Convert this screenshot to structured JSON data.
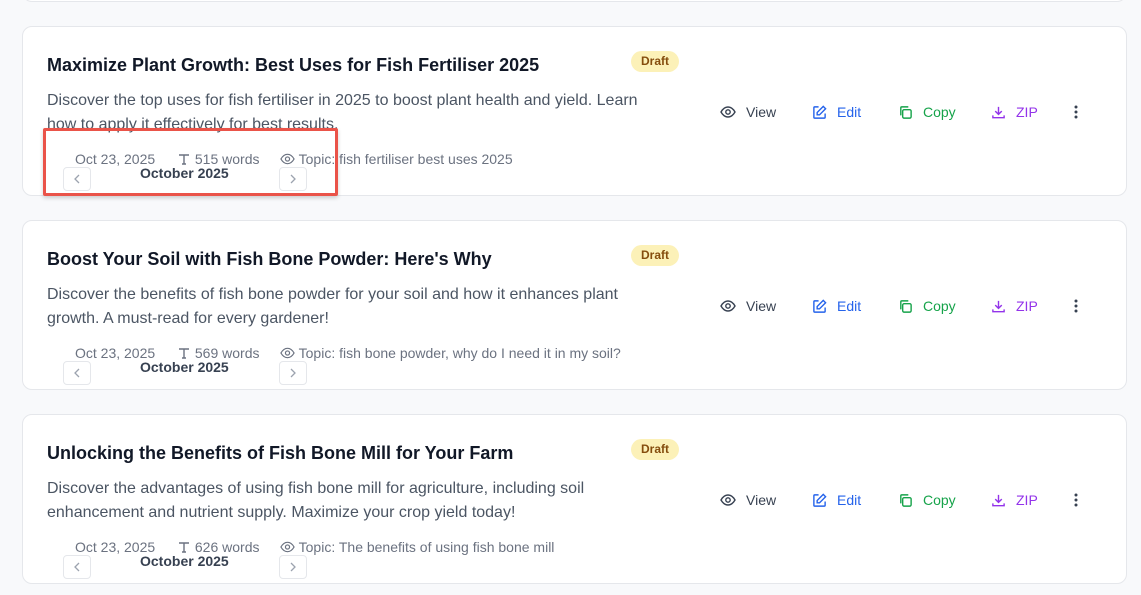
{
  "posts": [
    {
      "title": "Maximize Plant Growth: Best Uses for Fish Fertiliser 2025",
      "badge": "Draft",
      "description": "Discover the top uses for fish fertiliser in 2025 to boost plant health and yield. Learn how to apply it effectively for best results.",
      "date": "Oct 23, 2025",
      "words": "515 words",
      "topic": "Topic: fish fertiliser best uses 2025",
      "month": "October 2025"
    },
    {
      "title": "Boost Your Soil with Fish Bone Powder: Here's Why",
      "badge": "Draft",
      "description": "Discover the benefits of fish bone powder for your soil and how it enhances plant growth. A must-read for every gardener!",
      "date": "Oct 23, 2025",
      "words": "569 words",
      "topic": "Topic: fish bone powder, why do I need it in my soil?",
      "month": "October 2025"
    },
    {
      "title": "Unlocking the Benefits of Fish Bone Mill for Your Farm",
      "badge": "Draft",
      "description": "Discover the advantages of using fish bone mill for agriculture, including soil enhancement and nutrient supply. Maximize your crop yield today!",
      "date": "Oct 23, 2025",
      "words": "626 words",
      "topic": "Topic: The benefits of using fish bone mill",
      "month": "October 2025"
    }
  ],
  "actions": {
    "view": "View",
    "edit": "Edit",
    "copy": "Copy",
    "zip": "ZIP"
  },
  "colors": {
    "draft_bg": "#fcf1b8",
    "draft_text": "#854d0e",
    "edit": "#2563eb",
    "copy": "#16a34a",
    "zip": "#9333ea",
    "highlight": "#ea5349"
  },
  "icons": [
    "eye-icon",
    "pencil-square-icon",
    "copy-icon",
    "download-icon",
    "more-vertical-icon",
    "text-type-icon",
    "chevron-left-icon",
    "chevron-right-icon"
  ]
}
